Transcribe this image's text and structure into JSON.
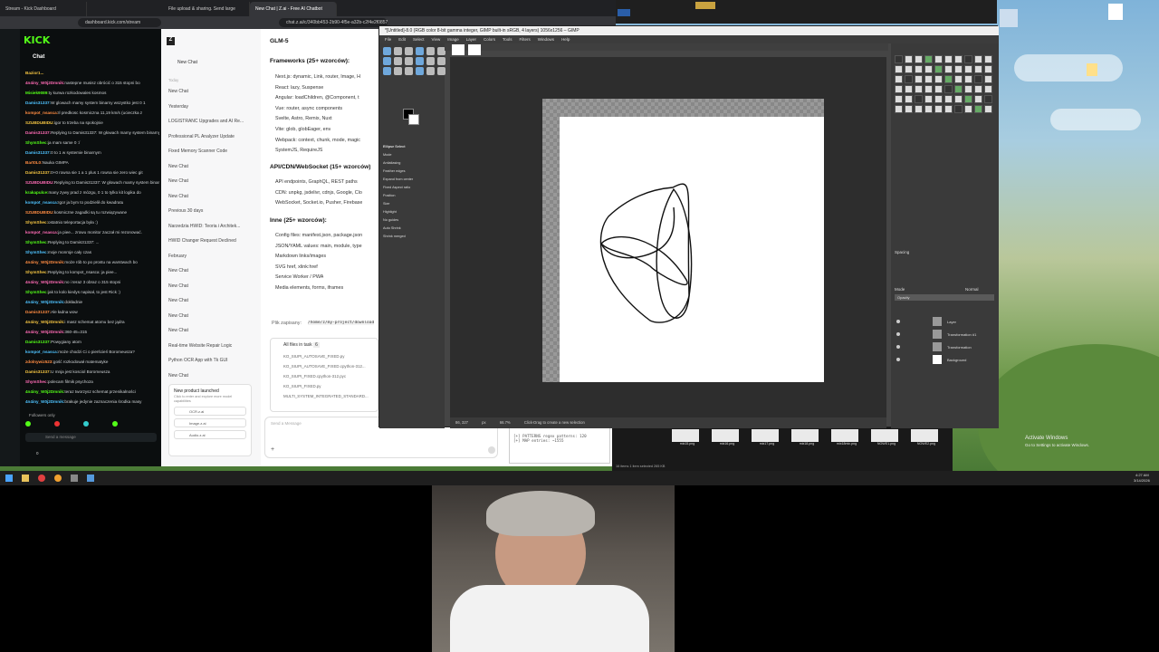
{
  "browser": {
    "tabs": [
      "Stream - Kick Dashboard",
      "File upload & sharing. Send large",
      "New Chat | Z.ai - Free AI Chatbot"
    ],
    "address": "dashboard.kick.com/stream",
    "address2": "chat.z.ai/c/340bb453-2b90-4f5e-a32b-c2f4e2f0857"
  },
  "kick": {
    "logo": "KICK",
    "chat_title": "Chat",
    "lines": [
      {
        "user": "Bazior1...",
        "text": ""
      },
      {
        "user": "4n4iny_W0j2Dmnik:",
        "text": "nastepne musisz obrócić o 315 stopni bo"
      },
      {
        "user": "Misiek9089:",
        "text": "ty kurwa rozkodowales kosmos"
      },
      {
        "user": "Damis31337:",
        "text": "W glowach mamy system binarny wszystko jest 0 1"
      },
      {
        "user": "kompot_nsasca:",
        "text": "Il predkosc kosmiczna 11,19 km/s (ucieczka z"
      },
      {
        "user": "SZUBDUBIDU:",
        "text": "igor to trzeba na spokojnie"
      },
      {
        "user": "Damis31337:",
        "text": "Replying to Damis31337: W głowach mamy system binarny"
      },
      {
        "user": "ShymShec:",
        "text": "ja mam same 0 :/"
      },
      {
        "user": "Damis31337:",
        "text": "0 to 1 w systemie binarnym"
      },
      {
        "user": "Bart0L0:",
        "text": "Nauka GIMPA"
      },
      {
        "user": "Damis31337:",
        "text": "0+0 rowna sie 1 a 1 plus 1 rowna sie zero wiec git"
      },
      {
        "user": "SZUBDUBIDU:",
        "text": "Replying to Damis31337: W głowach mamy system binarny"
      },
      {
        "user": "krakapulce:",
        "text": "many zywy prad z mózgu, 0 1 to tylko kit logika do"
      },
      {
        "user": "kompot_nsasca:",
        "text": "Igor ja bym to podzielił do kwadratu"
      },
      {
        "user": "SZUBDUBIDU:",
        "text": "kosmiczne zagadki są tu rozwiązywane"
      },
      {
        "user": "ShymShec:",
        "text": "ostatnio teleportacja była :)"
      },
      {
        "user": "kompot_nsasca:",
        "text": "ja piee... zrowu monitor zaczał mi rezonować."
      },
      {
        "user": "ShymShec:",
        "text": "Replying to Damis31337: ..."
      },
      {
        "user": "ShymShec:",
        "text": "moje monroje cały czas"
      },
      {
        "user": "4n4iny_W0j2Dmnik:",
        "text": "może rób to po prostu na warstwach bo"
      },
      {
        "user": "ShymShec:",
        "text": "Replying to kompot_nsasca: ja piee..."
      },
      {
        "user": "4n4iny_W0j2Dmnik:",
        "text": "no i teraz 3 obraz o 315 stopni"
      },
      {
        "user": "ShymShec:",
        "text": "jak to kolo kiedys napisał, to jest Rick :)"
      },
      {
        "user": "4n4iny_W0j2Dmnik:",
        "text": "dokładnie"
      },
      {
        "user": "Damis31337:",
        "text": "Ale ładna wow"
      },
      {
        "user": "4n4iny_W0j2Dmnik:",
        "text": "i masz schemat atomu bez jądra"
      },
      {
        "user": "4n4iny_W0j2Dmnik:",
        "text": "360-45=315"
      },
      {
        "user": "Damis31337:",
        "text": "Powygiany atom"
      },
      {
        "user": "kompot_nsasca:",
        "text": "może chodzi Ci o pierścień Boromeusza?"
      },
      {
        "user": "zdolnywiz523:",
        "text": "gość rozkodował matematyke"
      },
      {
        "user": "Damis31337:",
        "text": "U mnja jest kosciol Boromeusza"
      },
      {
        "user": "ShymShec:",
        "text": "polecam filmik psychoza"
      },
      {
        "user": "4n4iny_W0j2Dmnik:",
        "text": "teraz tworzysz schemat przenikalności"
      },
      {
        "user": "4n4iny_W0j2Dmnik:",
        "text": "brakuje jedynie zaznaczenia środka masy"
      }
    ],
    "followers": "Followers only",
    "send_placeholder": "Send a message",
    "count": "0"
  },
  "zai": {
    "logo": "Z",
    "new_chat": "New Chat",
    "today": "Today",
    "items": [
      "New Chat",
      "Yesterday",
      "LOGISTRANC Upgrades and AI Re...",
      "Professional PL Analyzer Update",
      "Fixed Memory Scanner Code",
      "New Chat",
      "New Chat",
      "New Chat",
      "Previous 30 days",
      "Narzedzia HWID: Teoria i Architek...",
      "HWID Changer Request Declined",
      "February",
      "New Chat",
      "New Chat",
      "New Chat",
      "New Chat",
      "New Chat",
      "Real-time Website Repair Logic",
      "Python OCR App with Tk GUI",
      "New Chat"
    ],
    "promo_title": "New product launched",
    "promo_text": "Click to enter and explore more model capabilities",
    "promo_items": [
      "OCR.z.ai",
      "Image.z.ai",
      "Audio.z.ai"
    ],
    "model": "GLM-5",
    "h1": "Frameworks (25+ wzorców):",
    "b1": [
      "Next.js: dynamic, Link, router, Image, H",
      "React: lazy, Suspense",
      "Angular: loadChildren, @Component, t",
      "Vue: router, async components",
      "Svelte, Astro, Remix, Nuxt",
      "Vite: glob, globEager, env",
      "Webpack: context, chunk, mode, magic",
      "SystemJS, RequireJS"
    ],
    "h2": "API/CDN/WebSocket (15+ wzorców)",
    "b2": [
      "API endpoints, GraphQL, REST paths",
      "CDN: unpkg, jsdelivr, cdnjs, Google, Clo",
      "WebSocket, Socket.io, Pusher, Firebase"
    ],
    "h3": "Inne (25+ wzorców):",
    "b3": [
      "Config files: manifest.json, package.json",
      "JSON/YAML values: main, module, type",
      "Markdown links/images",
      "SVG href, xlink:href",
      "Service Worker / PWA",
      "Media elements, forms, iframes"
    ],
    "saved": "Plik zapisany:",
    "saved_path": "/home/z/my-project/download",
    "files_title": "All files in task",
    "files_count": "6",
    "files": [
      "KO_SIUPI_AUTOSAVE_FIXED.py",
      "KO_SIUPI_AUTOSAVE_FIXED.cpython-312...",
      "KO_SIUPI_FIXED.cpython-312.pyc",
      "KO_SIUPI_FIXED.py",
      "MULTI_SYSTEM_INTEGRATED_STANDARD..."
    ],
    "send_placeholder": "Send a Message"
  },
  "gimp": {
    "title": "*[Untitled]-8.0 (RGB color 8-bit gamma integer, GIMP built-in sRGB, 4 layers) 1056x1256 – GIMP",
    "menu": [
      "File",
      "Edit",
      "Select",
      "View",
      "Image",
      "Layer",
      "Colors",
      "Tools",
      "Filters",
      "Windows",
      "Help"
    ],
    "tool_options": [
      "Ellipse Select",
      "Mode",
      "Antialiasing",
      "Feather edges",
      "Expand from center",
      "Fixed Aspect ratio",
      "Position",
      "Size",
      "Highlight",
      "No guides",
      "Auto Shrink",
      "Shrink merged"
    ],
    "zoom": "66.7%",
    "unit": "px",
    "coords": "86, 327",
    "status": "Click-Drag to create a new selection",
    "layers": [
      "Layer",
      "Transformation #1",
      "Transformation",
      "Background"
    ],
    "mode": "Normal",
    "opacity_label": "Opacity",
    "spacing_label": "Spacing"
  },
  "terminal": {
    "line1": "[+] PATTERNS regex patterns: 120",
    "line2": "[+] MAP entries: ~1555"
  },
  "explorer": {
    "files": [
      "mix15.png",
      "mix16.png",
      "mix17.png",
      "mix18.png",
      "mix18mix.png",
      "NOWE1.png",
      "NOWE2.png"
    ],
    "status": "16 items  1 item selected 265 KB"
  },
  "watermark": {
    "line1": "Activate Windows",
    "line2": "Go to Settings to activate Windows."
  },
  "taskbar": {
    "time": "4:27 AM",
    "date": "3/14/2026"
  }
}
